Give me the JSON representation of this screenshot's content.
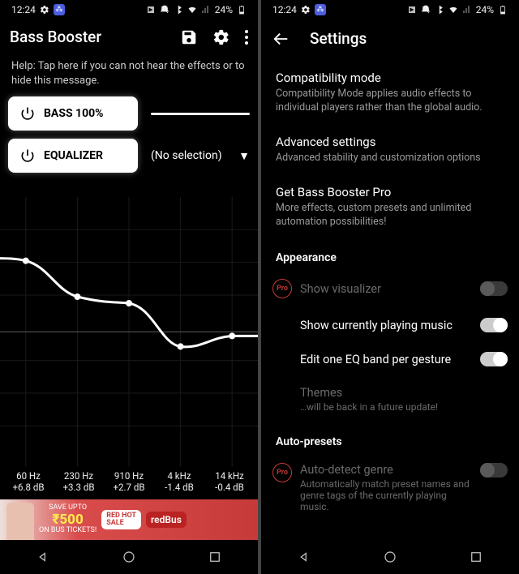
{
  "status": {
    "time": "12:24",
    "battery": "24%"
  },
  "left": {
    "title": "Bass Booster",
    "help": "Help: Tap here if you can not hear the effects or to hide this message.",
    "bass_btn": "BASS 100%",
    "eq_btn": "EQUALIZER",
    "dropdown": "(No selection)",
    "bands": [
      {
        "hz": "60 Hz",
        "db": "+6.8 dB"
      },
      {
        "hz": "230 Hz",
        "db": "+3.3 dB"
      },
      {
        "hz": "910 Hz",
        "db": "+2.7 dB"
      },
      {
        "hz": "4 kHz",
        "db": "-1.4 dB"
      },
      {
        "hz": "14 kHz",
        "db": "-0.4 dB"
      }
    ],
    "ad": {
      "line1": "SAVE UPTO",
      "amount": "₹500",
      "line3": "ON BUS TICKETS!",
      "redhot1": "RED HOT",
      "redhot2": "SALE",
      "brand": "redBus"
    }
  },
  "right": {
    "title": "Settings",
    "items": {
      "compat_t": "Compatibility mode",
      "compat_d": "Compatibility Mode applies audio effects to individual players rather than the global audio.",
      "adv_t": "Advanced settings",
      "adv_d": "Advanced stability and customization options",
      "pro_t": "Get Bass Booster Pro",
      "pro_d": "More effects, custom presets and unlimited automation possibilities!"
    },
    "appearance_header": "Appearance",
    "toggles": {
      "visualizer": "Show visualizer",
      "playing": "Show currently playing music",
      "gesture": "Edit one EQ band per gesture",
      "themes_t": "Themes",
      "themes_d": "…will be back in a future update!"
    },
    "auto_header": "Auto-presets",
    "auto": {
      "title": "Auto-detect genre",
      "desc": "Automatically match preset names and genre tags of the currently playing music."
    },
    "pro_label": "Pro"
  }
}
